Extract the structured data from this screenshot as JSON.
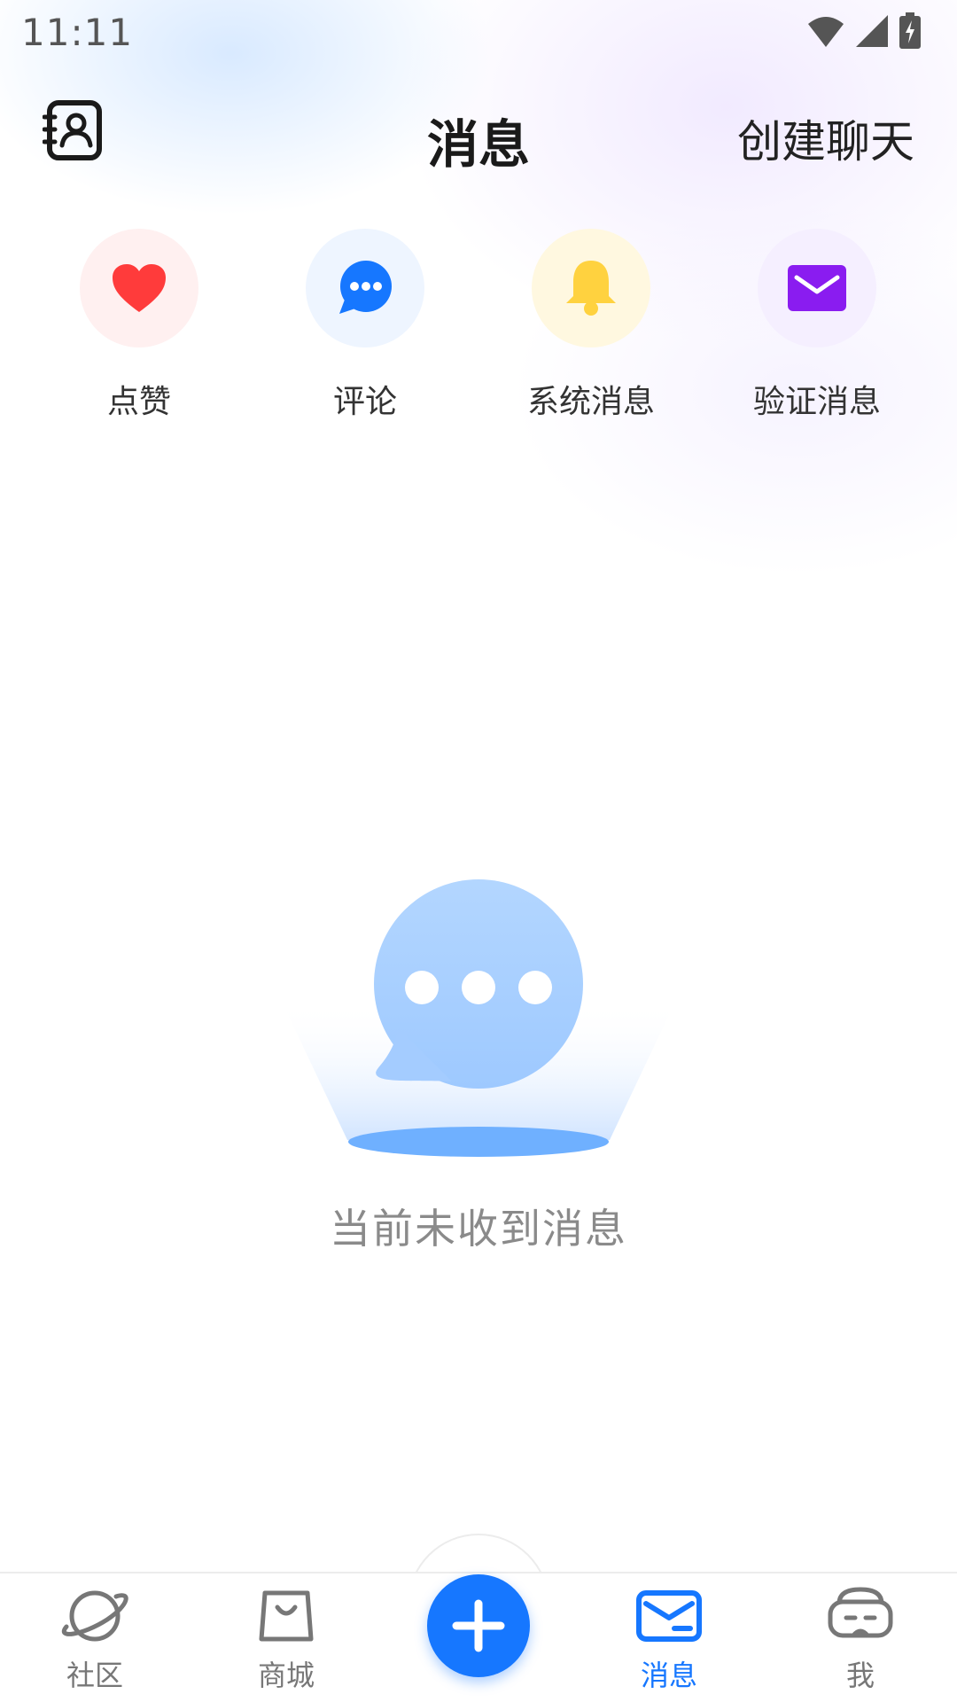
{
  "status_bar": {
    "time": "11:11"
  },
  "header": {
    "title": "消息",
    "create_chat_label": "创建聊天"
  },
  "quick_entries": [
    {
      "label": "点赞",
      "icon": "heart-icon",
      "bg_color": "#fff0f0",
      "icon_color": "#ff3b3b"
    },
    {
      "label": "评论",
      "icon": "comment-icon",
      "bg_color": "#eef5ff",
      "icon_color": "#1677ff"
    },
    {
      "label": "系统消息",
      "icon": "bell-icon",
      "bg_color": "#fff8e0",
      "icon_color": "#ffd23f"
    },
    {
      "label": "验证消息",
      "icon": "envelope-icon",
      "bg_color": "#f5efff",
      "icon_color": "#8a1cf0"
    }
  ],
  "empty_state": {
    "text": "当前未收到消息",
    "icon": "chat-bubble-icon"
  },
  "bottom_nav": {
    "items": [
      {
        "label": "社区",
        "icon": "planet-icon",
        "active": false
      },
      {
        "label": "商城",
        "icon": "shopping-bag-icon",
        "active": false
      },
      {
        "label": "消息",
        "icon": "mail-icon",
        "active": true
      },
      {
        "label": "我",
        "icon": "vr-headset-icon",
        "active": false
      }
    ],
    "fab_icon": "plus-icon"
  },
  "colors": {
    "accent": "#1677ff",
    "muted_text": "#8a8a8a"
  }
}
